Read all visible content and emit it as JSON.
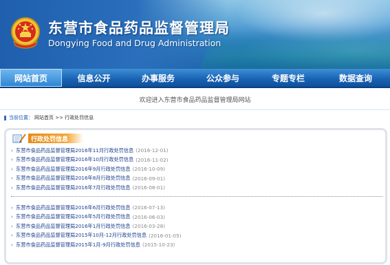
{
  "header": {
    "title_cn": "东营市食品药品监督管理局",
    "title_en": "Dongying Food and Drug Administration",
    "emblem_icon": "national-emblem-icon"
  },
  "nav": {
    "items": [
      {
        "label": "网站首页",
        "active": true
      },
      {
        "label": "信息公开",
        "active": false
      },
      {
        "label": "办事服务",
        "active": false
      },
      {
        "label": "公众参与",
        "active": false
      },
      {
        "label": "专题专栏",
        "active": false
      },
      {
        "label": "数据查询",
        "active": false
      }
    ]
  },
  "welcome": "欢迎进入东营市食品药品监督管理局网站",
  "breadcrumb": {
    "prefix": "当前位置：",
    "path": "网站首页 >> 行政处罚信息"
  },
  "section": {
    "title": "行政处罚信息",
    "group1": [
      {
        "title": "东营市食品药品监督管理局2016年11月行政处罚信息",
        "date": "(2016-12-01)"
      },
      {
        "title": "东营市食品药品监督管理局2016年10月行政处罚信息",
        "date": "(2016-11-02)"
      },
      {
        "title": "东营市食品药品监督管理局2016年9月行政处罚信息",
        "date": "(2016-10-09)"
      },
      {
        "title": "东营市食品药品监督管理局2016年8月行政处罚信息",
        "date": "(2016-09-01)"
      },
      {
        "title": "东营市食品药品监督管理局2016年7月行政处罚信息",
        "date": "(2016-08-01)"
      }
    ],
    "group2": [
      {
        "title": "东营市食品药品监督管理局2016年6月行政处罚信息",
        "date": "(2016-07-13)"
      },
      {
        "title": "东营市食品药品监督管理局2016年5月行政处罚信息",
        "date": "(2016-06-03)"
      },
      {
        "title": "东营市食品药品监督管理局2016年1月行政处罚信息",
        "date": "(2016-03-28)"
      },
      {
        "title": "东营市食品药品监督管理局2015年10月-12月行政处罚信息",
        "date": "(2016-01-05)"
      },
      {
        "title": "东营市食品药品监督管理局2015年1月-9月行政处罚信息",
        "date": "(2015-10-23)"
      }
    ]
  },
  "colors": {
    "nav_blue": "#1a64b5",
    "link_blue": "#1a3f8f",
    "section_orange": "#e78a1a"
  }
}
